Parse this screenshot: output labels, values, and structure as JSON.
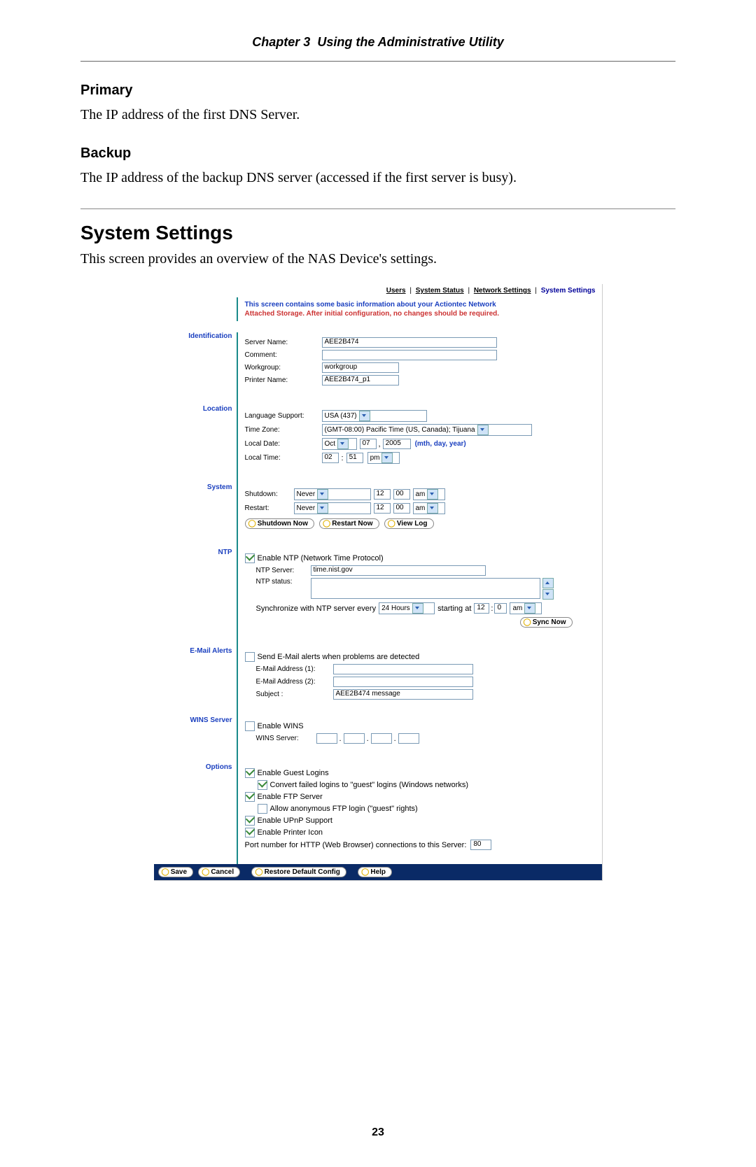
{
  "chapter": {
    "num": "Chapter 3",
    "title": "Using the Administrative Utility"
  },
  "doc": {
    "primary_h": "Primary",
    "primary_p": "The IP address of the first DNS Server.",
    "backup_h": "Backup",
    "backup_p": "The IP address of the backup DNS server (accessed if the first server is busy).",
    "sys_h": "System Settings",
    "sys_p": "This screen provides an overview of the NAS Device's settings.",
    "pagenum": "23"
  },
  "shot": {
    "tabs": {
      "users": "Users",
      "status": "System Status",
      "network": "Network Settings",
      "system": "System Settings",
      "sep": "|"
    },
    "intro_line1": "This screen contains some basic information about your Actiontec Network",
    "intro_line2": "Attached Storage. After initial configuration, no changes should be required.",
    "sections": {
      "ident": "Identification",
      "loc": "Location",
      "sys": "System",
      "ntp": "NTP",
      "email": "E-Mail Alerts",
      "wins": "WINS Server",
      "opts": "Options"
    },
    "ident": {
      "server_name_lbl": "Server Name:",
      "server_name": "AEE2B474",
      "comment_lbl": "Comment:",
      "comment": "",
      "workgroup_lbl": "Workgroup:",
      "workgroup": "workgroup",
      "printer_lbl": "Printer Name:",
      "printer": "AEE2B474_p1"
    },
    "loc": {
      "lang_lbl": "Language Support:",
      "lang": "USA (437)",
      "tz_lbl": "Time Zone:",
      "tz": "(GMT-08:00) Pacific Time (US, Canada); Tijuana",
      "date_lbl": "Local Date:",
      "m": "Oct",
      "d": "07",
      "y": "2005",
      "hint": "(mth, day, year)",
      "time_lbl": "Local Time:",
      "hh": "02",
      "mm": "51",
      "ampm": "pm"
    },
    "sys": {
      "shut_lbl": "Shutdown:",
      "shut": "Never",
      "shut_h": "12",
      "shut_m": "00",
      "shut_ap": "am",
      "rest_lbl": "Restart:",
      "rest": "Never",
      "rest_h": "12",
      "rest_m": "00",
      "rest_ap": "am",
      "b_shutdown": "Shutdown Now",
      "b_restart": "Restart Now",
      "b_log": "View Log"
    },
    "ntp": {
      "enable": "Enable NTP (Network Time Protocol)",
      "srv_lbl": "NTP Server:",
      "srv": "time.nist.gov",
      "status_lbl": "NTP status:",
      "status": "",
      "sync_pre": "Synchronize with NTP server every",
      "interval": "24 Hours",
      "starting": "starting at",
      "hh": "12",
      "mm": "0",
      "ap": "am",
      "b_sync": "Sync Now"
    },
    "email": {
      "enable": "Send E-Mail alerts when problems are detected",
      "a1_lbl": "E-Mail Address (1):",
      "a1": "",
      "a2_lbl": "E-Mail Address (2):",
      "a2": "",
      "subj_lbl": "Subject :",
      "subj": "AEE2B474 message"
    },
    "wins": {
      "enable": "Enable WINS",
      "srv_lbl": "WINS Server:",
      "dot": "."
    },
    "opts": {
      "guest": "Enable Guest Logins",
      "guest_sub": "Convert failed logins to \"guest\" logins (Windows networks)",
      "ftp": "Enable FTP Server",
      "ftp_sub": "Allow anonymous FTP login (\"guest\" rights)",
      "upnp": "Enable UPnP Support",
      "printer": "Enable Printer Icon",
      "port_lbl": "Port number for HTTP (Web Browser) connections to this Server:",
      "port": "80"
    },
    "footer": {
      "save": "Save",
      "cancel": "Cancel",
      "restore": "Restore Default Config",
      "help": "Help"
    }
  }
}
